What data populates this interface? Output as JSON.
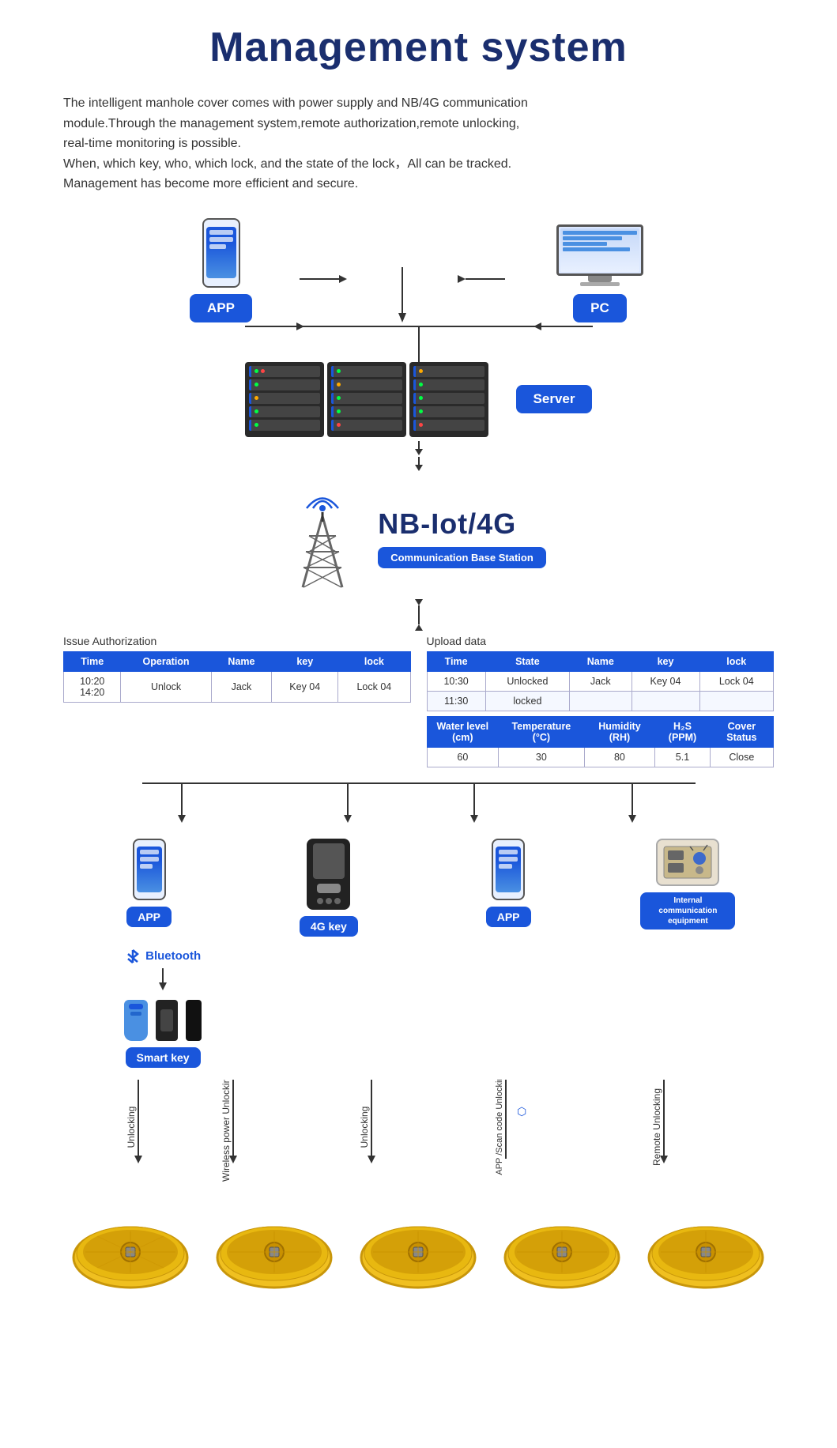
{
  "title": "Management system",
  "description": {
    "line1": "The intelligent manhole cover comes with power supply and NB/4G communication",
    "line2": "module.Through the management system,remote authorization,remote unlocking,",
    "line3": "real-time monitoring is possible.",
    "line4": "When, which key, who, which lock, and the state of the lock，All can be tracked.",
    "line5": "Management has become more efficient and secure."
  },
  "badges": {
    "app": "APP",
    "pc": "PC",
    "server": "Server",
    "nb_iot": "NB-Iot/4G",
    "comm_base": "Communication Base Station",
    "app2": "APP",
    "key_4g": "4G key",
    "app3": "APP",
    "internal_equip": "Internal communication equipment",
    "smart_key": "Smart key",
    "bluetooth": "Bluetooth"
  },
  "issue_table": {
    "title": "Issue Authorization",
    "headers": [
      "Time",
      "Operation",
      "Name",
      "key",
      "lock"
    ],
    "rows": [
      [
        "10:20\n14:20",
        "Unlock",
        "Jack",
        "Key 04",
        "Lock 04"
      ]
    ]
  },
  "upload_table": {
    "title": "Upload data",
    "headers1": [
      "Time",
      "State",
      "Name",
      "key",
      "lock"
    ],
    "rows1": [
      [
        "10:30",
        "Unlocked",
        "Jack",
        "Key 04",
        "Lock 04"
      ],
      [
        "11:30",
        "locked",
        "",
        "",
        ""
      ]
    ],
    "headers2": [
      "Water level (cm)",
      "Temperature (°C)",
      "Humidity (RH)",
      "H₂S (PPM)",
      "Cover Status"
    ],
    "rows2": [
      [
        "60",
        "30",
        "80",
        "5.1",
        "Close"
      ]
    ]
  },
  "vertical_labels": {
    "unlocking": "Unlocking",
    "wireless_unlocking": "Wireless power Unlocking",
    "unlocking2": "Unlocking",
    "app_scan": "APP /Scan code Unlocking",
    "remote": "Remote Unlocking"
  },
  "colors": {
    "primary": "#1a56db",
    "dark": "#1a2e6e",
    "text": "#333333"
  }
}
